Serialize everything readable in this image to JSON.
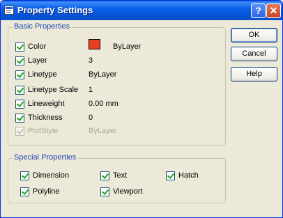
{
  "window": {
    "title": "Property Settings"
  },
  "titlebar": {
    "help_label": "?",
    "close_label": "✕"
  },
  "basic": {
    "title": "Basic Properties",
    "color_swatch": "#E8401C",
    "rows": [
      {
        "label": "Color",
        "value": "ByLayer",
        "checked": true,
        "enabled": true
      },
      {
        "label": "Layer",
        "value": "3",
        "checked": true,
        "enabled": true
      },
      {
        "label": "Linetype",
        "value": "ByLayer",
        "checked": true,
        "enabled": true
      },
      {
        "label": "Linetype Scale",
        "value": "1",
        "checked": true,
        "enabled": true
      },
      {
        "label": "Lineweight",
        "value": "0.00 mm",
        "checked": true,
        "enabled": true
      },
      {
        "label": "Thickness",
        "value": "0",
        "checked": true,
        "enabled": true
      },
      {
        "label": "PlotStyle",
        "value": "ByLayer",
        "checked": true,
        "enabled": false
      }
    ]
  },
  "special": {
    "title": "Special Properties",
    "items": [
      {
        "label": "Dimension",
        "checked": true
      },
      {
        "label": "Text",
        "checked": true
      },
      {
        "label": "Hatch",
        "checked": true
      },
      {
        "label": "Polyline",
        "checked": true
      },
      {
        "label": "Viewport",
        "checked": true
      }
    ]
  },
  "buttons": {
    "ok": "OK",
    "cancel": "Cancel",
    "help": "Help"
  }
}
